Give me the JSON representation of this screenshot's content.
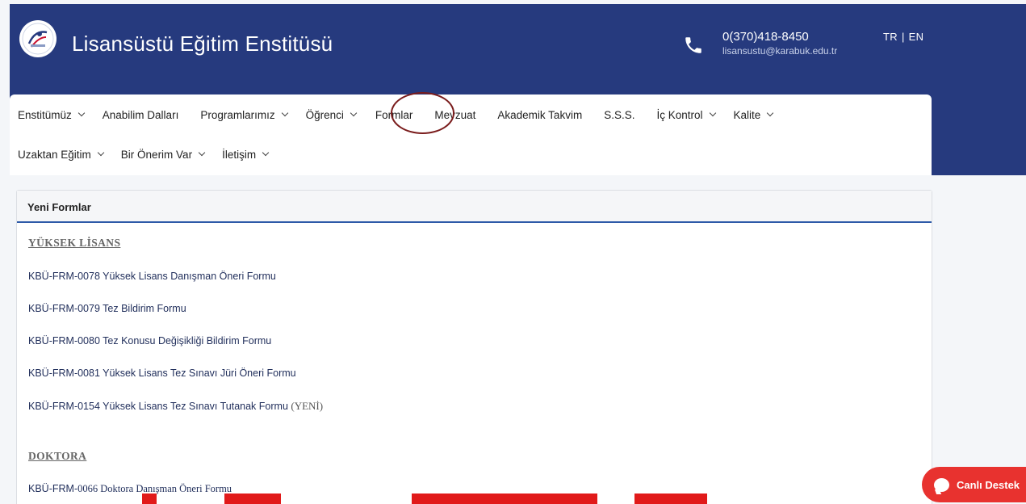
{
  "header": {
    "title": "Lisansüstü Eğitim Enstitüsü",
    "phone": "0(370)418-8450",
    "email": "lisansustu@karabuk.edu.tr",
    "lang_tr": "TR",
    "lang_sep": "|",
    "lang_en": "EN"
  },
  "nav": {
    "row1": [
      {
        "label": "Enstitümüz",
        "dropdown": true
      },
      {
        "label": "Anabilim Dalları",
        "dropdown": false
      },
      {
        "label": "Programlarımız",
        "dropdown": true
      },
      {
        "label": "Öğrenci",
        "dropdown": true
      },
      {
        "label": "Formlar",
        "dropdown": false
      },
      {
        "label": "Mevzuat",
        "dropdown": false
      },
      {
        "label": "Akademik Takvim",
        "dropdown": false
      },
      {
        "label": "S.S.S.",
        "dropdown": false
      },
      {
        "label": "İç Kontrol",
        "dropdown": true
      },
      {
        "label": "Kalite",
        "dropdown": true
      }
    ],
    "row2": [
      {
        "label": "Uzaktan Eğitim",
        "dropdown": true
      },
      {
        "label": "Bir Önerim Var",
        "dropdown": true
      },
      {
        "label": "İletişim",
        "dropdown": true
      }
    ]
  },
  "panel": {
    "heading": "Yeni Formlar",
    "sections": [
      {
        "title": "YÜKSEK LİSANS",
        "forms": [
          {
            "code_title": "KBÜ-FRM-0078 Yüksek Lisans Danışman Öneri Formu",
            "tag": ""
          },
          {
            "code_title": "KBÜ-FRM-0079 Tez Bildirim Formu",
            "tag": ""
          },
          {
            "code_title": "KBÜ-FRM-0080 Tez Konusu Değişikliği Bildirim Formu",
            "tag": ""
          },
          {
            "code_title": "KBÜ-FRM-0081 Yüksek Lisans Tez Sınavı Jüri Öneri Formu",
            "tag": ""
          },
          {
            "code_title": "KBÜ-FRM-0154 Yüksek Lisans Tez Sınavı Tutanak Formu",
            "tag": "(YENİ)"
          }
        ]
      },
      {
        "title": "DOKTORA",
        "forms": [
          {
            "code_title": "KBÜ-FRM-",
            "serif_part": "0066 Doktora Danışman Öneri Formu",
            "tag": ""
          }
        ]
      }
    ]
  },
  "live_support": {
    "label": "Canlı Destek"
  },
  "colors": {
    "header_bg": "#263a7e",
    "accent_line": "#2e5aa8",
    "live_btn": "#e8322f",
    "highlight_circle": "#7a1c1c"
  }
}
